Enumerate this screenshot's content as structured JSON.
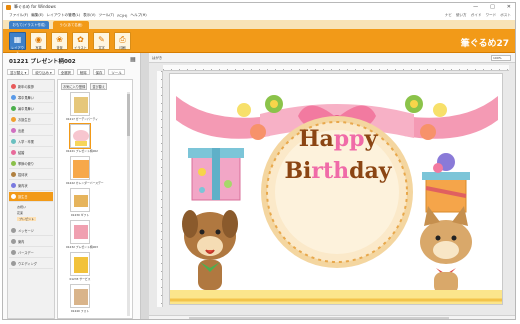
{
  "window": {
    "title": "筆ぐるめ for Windows",
    "controls": [
      "—",
      "□",
      "✕"
    ]
  },
  "menu": {
    "items": [
      "ファイル(F)",
      "編集(E)",
      "レイアウトの管理(L)",
      "表示(V)",
      "ツール(T)",
      "FC(H)",
      "ヘルプ(H)"
    ],
    "right": [
      "ナビ",
      "使い方",
      "ガイド",
      "ワード",
      "ポスト"
    ]
  },
  "mode_tabs": [
    "おもて(イラスト作成)",
    "うら(あて名面)"
  ],
  "toolbar": {
    "buttons": [
      {
        "label": "レイアウト",
        "icon": "layout-icon"
      },
      {
        "label": "写真",
        "icon": "photo-icon"
      },
      {
        "label": "背景",
        "icon": "background-icon"
      },
      {
        "label": "イラスト",
        "icon": "illust-icon"
      },
      {
        "label": "文字",
        "icon": "text-icon"
      },
      {
        "label": "印刷",
        "icon": "print-icon"
      }
    ],
    "brand": "筆ぐるめ27"
  },
  "left_panel": {
    "doc_title": "01221 プレゼント柄002",
    "tools": [
      "並び替え ▾",
      "絞り込み ▾",
      "全選択",
      "削除",
      "保存",
      "ツール"
    ],
    "categories": [
      "新年の挨拶",
      "寒中見舞い",
      "暑中見舞い",
      "お誕生日",
      "出産",
      "入学・卒業",
      "結婚",
      "季節の便り",
      "招待状",
      "案内状",
      "誕生日"
    ],
    "sub_items": [
      "お祝い",
      "花束",
      "プレゼント"
    ],
    "lower_categories": [
      "メッセージ",
      "案内",
      "バースデー",
      "ウエディング"
    ],
    "thumb_header": [
      "お気に入り登録",
      "並び替え"
    ],
    "thumbs": [
      {
        "caption": "01217 ガーデンパーティ"
      },
      {
        "caption": "01221 プレゼント柄002"
      },
      {
        "caption": "01222 カレンダーバースデー"
      },
      {
        "caption": "01230 ギフト"
      },
      {
        "caption": "01232 プレゼント柄003"
      },
      {
        "caption": "01233 サービス"
      },
      {
        "caption": "01240 フォト"
      }
    ]
  },
  "canvas": {
    "label": "はがき",
    "zoom": "100%"
  },
  "card": {
    "happy": [
      "Ha",
      "pp",
      "y"
    ],
    "birthday": [
      "Bi",
      "rth",
      "day"
    ]
  }
}
